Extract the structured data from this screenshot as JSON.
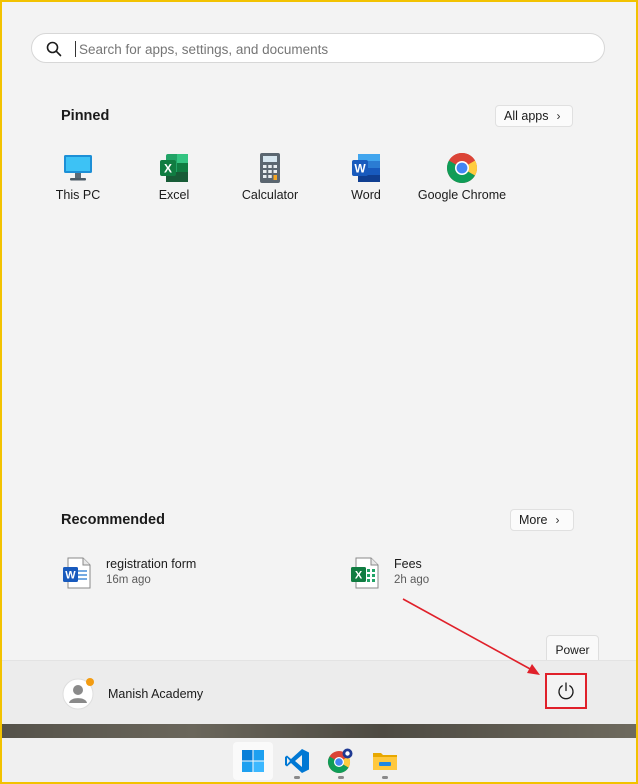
{
  "search": {
    "placeholder": "Search for apps, settings, and documents"
  },
  "pinned": {
    "title": "Pinned",
    "all_apps_label": "All apps",
    "apps": [
      {
        "label": "This PC",
        "icon": "monitor-icon"
      },
      {
        "label": "Excel",
        "icon": "excel-icon"
      },
      {
        "label": "Calculator",
        "icon": "calculator-icon"
      },
      {
        "label": "Word",
        "icon": "word-icon"
      },
      {
        "label": "Google Chrome",
        "icon": "chrome-icon"
      }
    ]
  },
  "recommended": {
    "title": "Recommended",
    "more_label": "More",
    "items": [
      {
        "name": "registration form",
        "time": "16m ago",
        "icon": "word-document-icon"
      },
      {
        "name": "Fees",
        "time": "2h ago",
        "icon": "excel-document-icon"
      }
    ]
  },
  "user": {
    "name": "Manish Academy",
    "status_color": "#f39c12"
  },
  "power": {
    "tooltip": "Power",
    "highlight_color": "#e0202a"
  },
  "taskbar": {
    "items": [
      "windows-start-icon",
      "vscode-icon",
      "chrome-icon",
      "file-explorer-icon"
    ]
  },
  "colors": {
    "frame_border": "#f2c200",
    "annotation_arrow": "#e0202a"
  }
}
